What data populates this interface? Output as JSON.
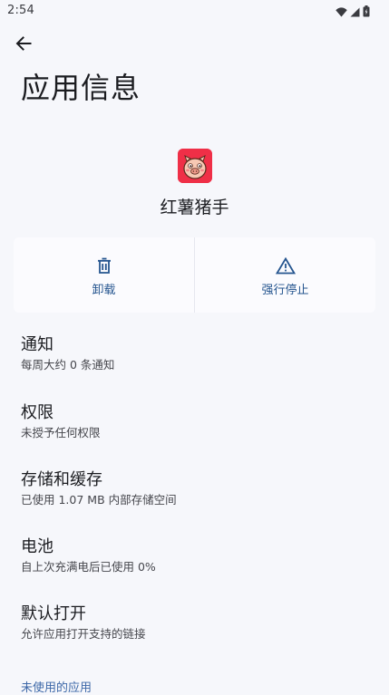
{
  "status_bar": {
    "time": "2:54",
    "icons": [
      "wifi-icon",
      "signal-icon",
      "battery-icon"
    ]
  },
  "header": {
    "back_icon": "arrow-left-icon",
    "title": "应用信息"
  },
  "app": {
    "name": "红薯猪手",
    "icon_color": "#ef2f47"
  },
  "actions": [
    {
      "label": "卸载",
      "icon": "trash-icon"
    },
    {
      "label": "强行停止",
      "icon": "warning-icon"
    }
  ],
  "settings": [
    {
      "title": "通知",
      "subtitle": "每周大约 0 条通知"
    },
    {
      "title": "权限",
      "subtitle": "未授予任何权限"
    },
    {
      "title": "存储和缓存",
      "subtitle": "已使用 1.07 MB 内部存储空间"
    },
    {
      "title": "电池",
      "subtitle": "自上次充满电后已使用 0%"
    },
    {
      "title": "默认打开",
      "subtitle": "允许应用打开支持的链接"
    }
  ],
  "section_header": "未使用的应用",
  "colors": {
    "background": "#f6f7fb",
    "accent": "#25558f",
    "app_icon_bg": "#ef2f47"
  }
}
